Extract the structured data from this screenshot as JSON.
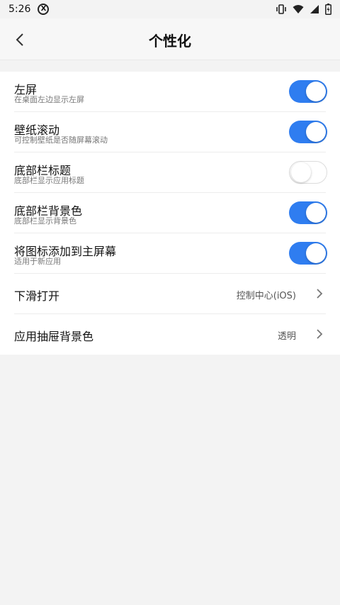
{
  "statusbar": {
    "time": "5:26",
    "badge": "X",
    "icons": [
      "vibrate-icon",
      "wifi-icon",
      "signal-icon",
      "battery-icon"
    ]
  },
  "header": {
    "title": "个性化",
    "back_icon": "back-arrow-icon"
  },
  "settings": [
    {
      "title": "左屏",
      "subtitle": "在桌面左边显示左屏",
      "toggle": true
    },
    {
      "title": "壁纸滚动",
      "subtitle": "可控制壁纸是否随屏幕滚动",
      "toggle": true
    },
    {
      "title": "底部栏标题",
      "subtitle": "底部栏显示应用标题",
      "toggle": false
    },
    {
      "title": "底部栏背景色",
      "subtitle": "底部栏显示背景色",
      "toggle": true
    },
    {
      "title": "将图标添加到主屏幕",
      "subtitle": "适用于新应用",
      "toggle": true
    },
    {
      "title": "下滑打开",
      "value": "控制中心(iOS)"
    },
    {
      "title": "应用抽屉背景色",
      "value": "透明"
    }
  ],
  "colors": {
    "accent": "#2f7df0",
    "background": "#f3f3f3",
    "card": "#ffffff"
  }
}
